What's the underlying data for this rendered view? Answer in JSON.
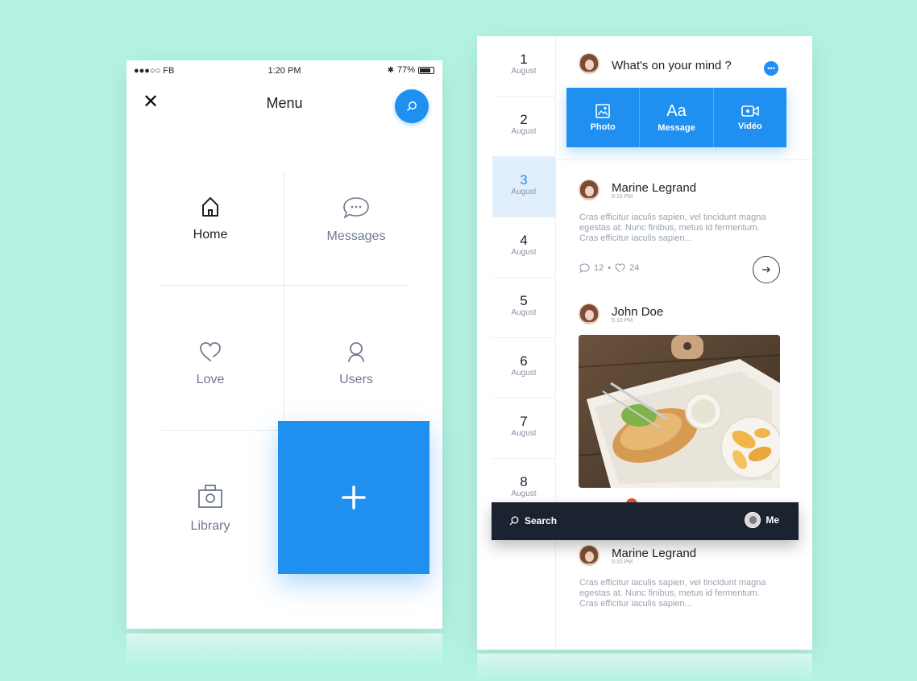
{
  "colors": {
    "background": "#b4f3e3",
    "accent": "#1f8ff0",
    "dark_bar": "#1b2330"
  },
  "status_bar": {
    "carrier": "●●●○○ FB",
    "time": "1:20 PM",
    "battery": "77%"
  },
  "menu": {
    "title": "Menu",
    "close_icon": "close-icon",
    "search_icon": "search-icon",
    "items": [
      {
        "label": "Home",
        "icon": "home-icon",
        "active": true
      },
      {
        "label": "Messages",
        "icon": "chat-bubble-icon",
        "active": false
      },
      {
        "label": "Love",
        "icon": "heart-icon",
        "active": false
      },
      {
        "label": "Users",
        "icon": "user-icon",
        "active": false
      },
      {
        "label": "Library",
        "icon": "camera-icon",
        "active": false
      }
    ],
    "add_icon": "plus-icon"
  },
  "dates": [
    {
      "day": "1",
      "month": "August"
    },
    {
      "day": "2",
      "month": "August"
    },
    {
      "day": "3",
      "month": "August",
      "active": true
    },
    {
      "day": "4",
      "month": "August"
    },
    {
      "day": "5",
      "month": "August"
    },
    {
      "day": "6",
      "month": "August"
    },
    {
      "day": "7",
      "month": "August"
    },
    {
      "day": "8",
      "month": "August"
    }
  ],
  "composer": {
    "prompt": "What's on your mind ?",
    "options": [
      {
        "label": "Photo",
        "icon": "image-icon"
      },
      {
        "label": "Message",
        "icon": "text-icon",
        "glyph": "Aa"
      },
      {
        "label": "Vidéo",
        "icon": "video-icon"
      }
    ]
  },
  "posts": [
    {
      "author": "Marine Legrand",
      "time": "5:10 PM",
      "body": "Cras efficitur iaculis sapien, vel tincidunt magna egestas at. Nunc finibus, metus id fermentum. Cras efficitur iaculis sapien...",
      "comments": "12",
      "likes": "24"
    },
    {
      "author": "John Doe",
      "time": "5:10 PM",
      "image": "food-photo"
    },
    {
      "author": "Marine Legrand",
      "time": "5:10 PM",
      "body": "Cras efficitur iaculis sapien, vel tincidunt magna egestas at. Nunc finibus, metus id fermentum. Cras efficitur iaculis sapien..."
    }
  ],
  "bottom_bar": {
    "search_label": "Search",
    "me_label": "Me"
  }
}
